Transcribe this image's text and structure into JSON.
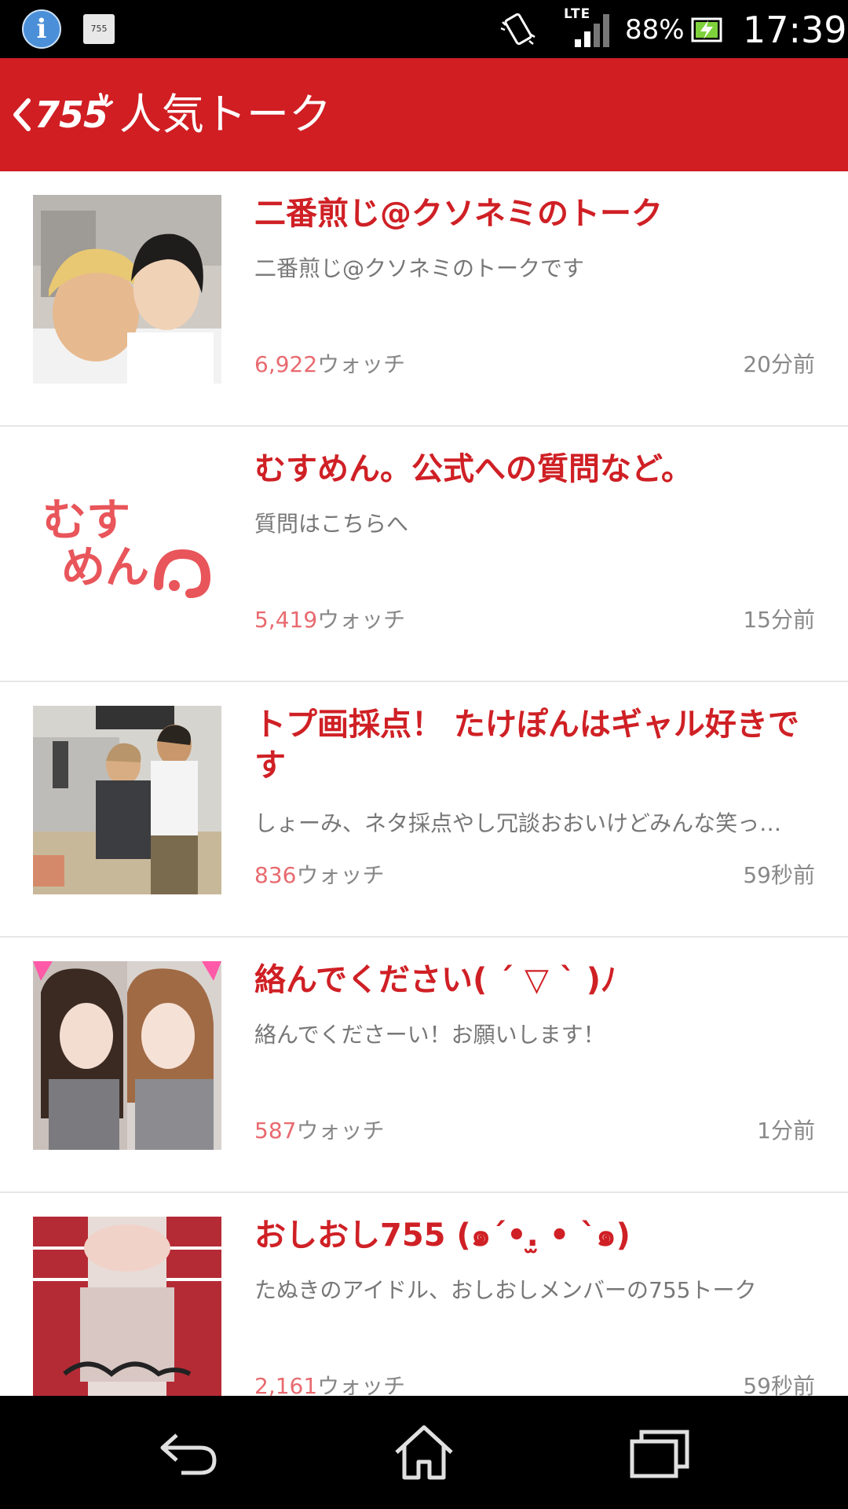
{
  "status_bar": {
    "info_icon_glyph": "i",
    "app_icon_text": "755",
    "network_label": "LTE",
    "battery_percent": "88%",
    "clock": "17:39"
  },
  "app_bar": {
    "logo_text": "755",
    "title": "人気トーク",
    "color": "#d01e23"
  },
  "talks": [
    {
      "title": "二番煎じ@クソネミのトーク",
      "description": "二番煎じ@クソネミのトークです",
      "watch_count": "6,922",
      "watch_label": "ウォッチ",
      "time": "20分前"
    },
    {
      "title": "むすめん。公式への質問など。",
      "description": "質問はこちらへ",
      "watch_count": "5,419",
      "watch_label": "ウォッチ",
      "time": "15分前",
      "thumb_text_line1": "むす",
      "thumb_text_line2": "めん"
    },
    {
      "title": "トプ画採点！ たけぽんはギャル好きです",
      "description": "しょーみ、ネタ採点やし冗談おおいけどみんな笑っ…",
      "watch_count": "836",
      "watch_label": "ウォッチ",
      "time": "59秒前"
    },
    {
      "title": "絡んでください( ´ ▽ ` )ﾉ",
      "description": "絡んでくださーい！お願いします！",
      "watch_count": "587",
      "watch_label": "ウォッチ",
      "time": "1分前"
    },
    {
      "title": "おしおし755 (๑´•.̫ • `๑)",
      "description": "たぬきのアイドル、おしおしメンバーの755トーク",
      "watch_count": "2,161",
      "watch_label": "ウォッチ",
      "time": "59秒前"
    }
  ],
  "icons": {
    "status": [
      "info-icon",
      "app-755-icon",
      "vibrate-icon",
      "signal-icon",
      "battery-icon"
    ],
    "nav": [
      "back-icon",
      "home-icon",
      "recent-apps-icon"
    ]
  },
  "colors": {
    "accent_red": "#d01e23",
    "title_red": "#cf2025",
    "count_pink": "#e86a6f",
    "meta_gray": "#888888"
  }
}
